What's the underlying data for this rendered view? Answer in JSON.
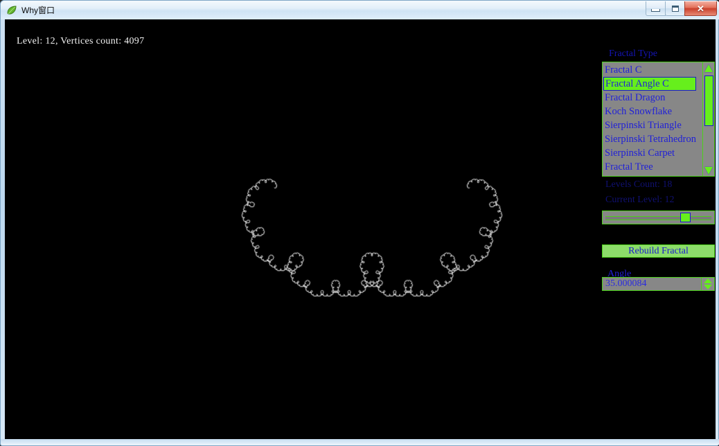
{
  "window": {
    "title": "Why窗口",
    "icon": "leaf-icon",
    "buttons": {
      "minimize": "minimize-icon",
      "maximize": "maximize-icon",
      "close": "✕"
    }
  },
  "canvas": {
    "status_text": "Level: 12, Vertices count: 4097",
    "background_color": "#000000",
    "curve_color": "#ffffff",
    "fractal": {
      "name": "Fractal Angle C",
      "level": 12,
      "vertices_count": 4097,
      "angle_degrees": 35.000084
    }
  },
  "panel": {
    "fractal_type_label": "Fractal Type",
    "fractal_types": [
      {
        "label": "Fractal C",
        "selected": false
      },
      {
        "label": "Fractal Angle C",
        "selected": true
      },
      {
        "label": "Fractal Dragon",
        "selected": false
      },
      {
        "label": "Koch Snowflake",
        "selected": false
      },
      {
        "label": "Sierpinski Triangle",
        "selected": false
      },
      {
        "label": "Sierpinski Tetrahedron",
        "selected": false
      },
      {
        "label": "Sierpinski Carpet",
        "selected": false
      },
      {
        "label": "Fractal Tree",
        "selected": false
      }
    ],
    "levels_count_label": "Levels Count: 18",
    "current_level_label": "Current Level: 12",
    "slider": {
      "value": 12,
      "min": 1,
      "max": 18,
      "percent": 72
    },
    "rebuild_label": "Rebuild Fractal",
    "angle_label": "Angle",
    "angle_value": "35.000084",
    "colors": {
      "accent_green": "#66ef1c",
      "button_green": "#8ddd6a",
      "text_blue": "#2020d8",
      "dim_blue": "#101070",
      "control_gray": "#878787"
    }
  }
}
